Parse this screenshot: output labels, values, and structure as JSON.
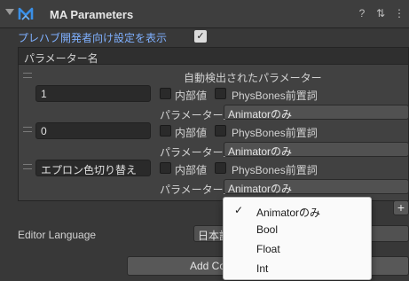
{
  "component": {
    "title": "MA Parameters"
  },
  "toggle": {
    "label": "プレハブ開発者向け設定を表示",
    "checked": true,
    "check_glyph": "✓"
  },
  "list": {
    "header": "パラメーター名",
    "auto_label": "自動検出されたパラメーター",
    "add_glyph": "+",
    "rows": [
      {
        "name": "1",
        "internal_label": "内部値",
        "physbones_label": "PhysBones前置詞",
        "type_label": "パラメーター型",
        "type_value": "Animatorのみ"
      },
      {
        "name": "0",
        "internal_label": "内部値",
        "physbones_label": "PhysBones前置詞",
        "type_label": "パラメーター型",
        "type_value": "Animatorのみ"
      },
      {
        "name": "エプロン色切り替え",
        "internal_label": "内部値",
        "physbones_label": "PhysBones前置詞",
        "type_label": "パラメーター型",
        "type_value": "Animatorのみ"
      }
    ]
  },
  "language": {
    "label": "Editor Language",
    "value": "日本語"
  },
  "add_button": {
    "label": "Add Co"
  },
  "dropdown": {
    "items": [
      "Animatorのみ",
      "Bool",
      "Float",
      "Int"
    ],
    "selected": "Animatorのみ",
    "tick_glyph": "✓"
  },
  "icons": [
    "foldout-arrow-icon",
    "ma-logo-icon",
    "help-icon",
    "preset-icon",
    "more-icon",
    "list-drag-handle-icon",
    "checkmark-icon"
  ]
}
